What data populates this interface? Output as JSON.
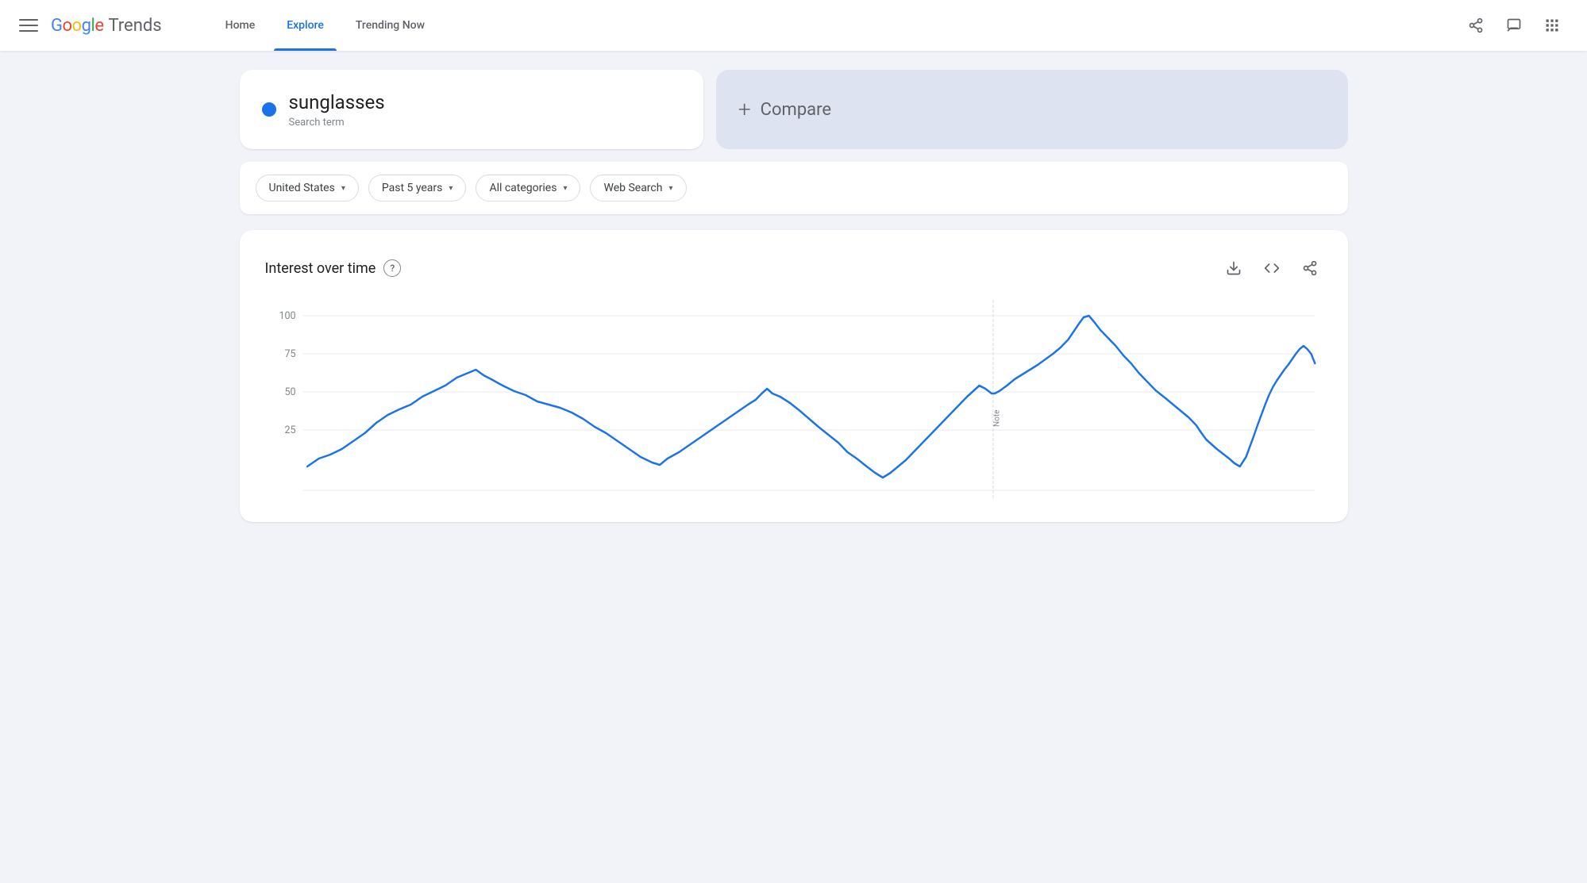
{
  "header": {
    "hamburger_label": "Menu",
    "logo_google": "Google",
    "logo_trends": "Trends",
    "nav": [
      {
        "label": "Home",
        "active": false,
        "id": "home"
      },
      {
        "label": "Explore",
        "active": true,
        "id": "explore"
      },
      {
        "label": "Trending Now",
        "active": false,
        "id": "trending"
      }
    ],
    "icons": {
      "share": "⤢",
      "feedback": "⬚",
      "apps": "⠿"
    }
  },
  "search_card": {
    "dot_color": "#1a73e8",
    "term": "sunglasses",
    "type": "Search term"
  },
  "compare_card": {
    "plus": "+",
    "label": "Compare"
  },
  "filters": [
    {
      "id": "region",
      "label": "United States",
      "has_arrow": true
    },
    {
      "id": "time",
      "label": "Past 5 years",
      "has_arrow": true
    },
    {
      "id": "category",
      "label": "All categories",
      "has_arrow": true
    },
    {
      "id": "search_type",
      "label": "Web Search",
      "has_arrow": true
    }
  ],
  "chart": {
    "title": "Interest over time",
    "help_label": "?",
    "actions": {
      "download": "↓",
      "embed": "<>",
      "share": "⤢"
    },
    "y_labels": [
      "100",
      "75",
      "50",
      "25"
    ],
    "note_label": "Note",
    "line_color": "#1a73e8"
  }
}
